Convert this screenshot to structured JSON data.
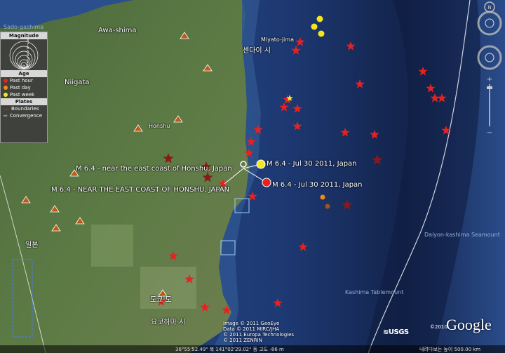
{
  "places": {
    "awashima": "Awa-shima",
    "niigata": "Niigata",
    "sendai": "센다이 시",
    "miyato": "Miyato-jima",
    "honshu": "Honshu",
    "japan_kr": "일본",
    "tokyo": "도쿄 도",
    "yokohama": "요코하마 시",
    "sadogashima": "Sado-gashima",
    "daiyon_seamount": "Daiyon-kashima Seamount",
    "kashima_tablemount": "Kashima Tablemount"
  },
  "quakes": {
    "label1": "M 6.4 - near the east coast of Honshu, Japan",
    "label2": "M 6.4 - Jul 30 2011, Japan",
    "label3": "M 6.4 - NEAR THE EAST COAST OF HONSHU, JAPAN",
    "label4": "M 6.4 - Jul 30 2011, Japan"
  },
  "legend": {
    "magnitude_title": "Magnitude",
    "magnitudes": [
      "8",
      "7",
      "6",
      "5",
      "4",
      "3",
      "2",
      "1"
    ],
    "age_title": "Age",
    "past_hour": "Past hour",
    "past_day": "Past day",
    "past_week": "Past week",
    "plates_title": "Plates",
    "boundaries": "Boundaries",
    "convergence": "Convergence"
  },
  "colors": {
    "past_hour": "#e82020",
    "past_day": "#f08a10",
    "past_week": "#f5e61a",
    "ocean": "#1d3970",
    "land": "#4f6b3c"
  },
  "attribution": {
    "line1": "Image © 2011 GeoEye",
    "line2": "Data © 2011 MIRC/JHA",
    "line3": "© 2011 Europa Technologies",
    "line4": "© 2011 ZENRIN"
  },
  "logos": {
    "usgs": "≋USGS",
    "google": "Google",
    "google_copyright": "©2010"
  },
  "status_bar": {
    "coords": "36°55'52.49\" 북  141°02'29.02\" 동  고도  -86 m",
    "stream": "내려다보는 높이  500.00 km"
  }
}
